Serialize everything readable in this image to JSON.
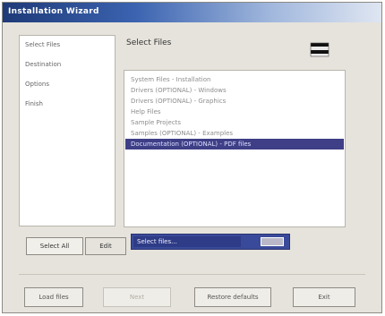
{
  "window": {
    "title": "Installation Wizard"
  },
  "left_panel": {
    "items": [
      "Select Files",
      "Destination",
      "Options",
      "Finish"
    ]
  },
  "right_panel": {
    "header": "Select Files",
    "list": [
      "System Files - Installation",
      "Drivers (OPTIONAL) - Windows",
      "Drivers (OPTIONAL) - Graphics",
      "Help Files",
      "Sample Projects",
      "Samples (OPTIONAL) - Examples",
      "Documentation (OPTIONAL) - PDF files"
    ],
    "selected_index": 6
  },
  "controls": {
    "tab_label": "Select All",
    "tab2_label": "Edit",
    "dropdown_value": "Select files..."
  },
  "footer": {
    "back_label": "Load files",
    "next_label": "Next",
    "defaults_label": "Restore defaults",
    "finish_label": "Exit"
  },
  "colors": {
    "title_bar": "#2c4e96",
    "selection": "#3e3f86"
  }
}
